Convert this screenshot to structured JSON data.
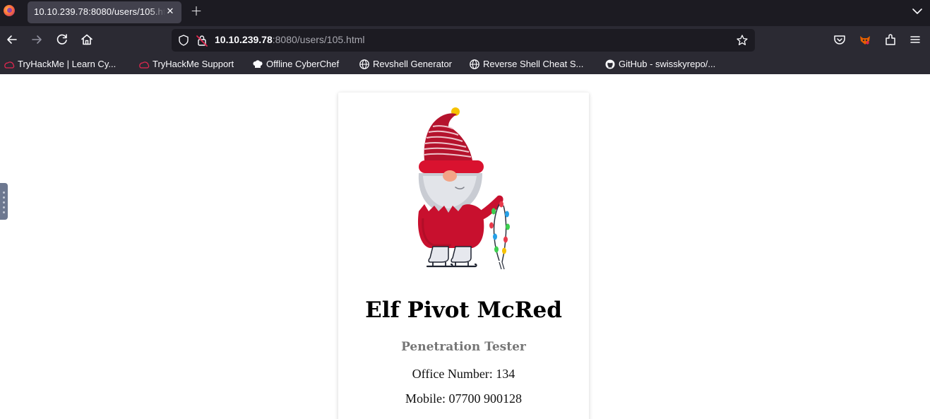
{
  "browser": {
    "tab": {
      "title": "10.10.239.78:8080/users/105.html",
      "close_icon": "close-icon"
    },
    "new_tab_icon": "plus-icon",
    "tab_list_icon": "chevron-down-icon",
    "nav": {
      "back_icon": "arrow-left-icon",
      "forward_icon": "arrow-right-icon",
      "reload_icon": "reload-icon",
      "home_icon": "home-icon"
    },
    "url": {
      "host": "10.10.239.78",
      "rest": ":8080/users/105.html"
    },
    "toolbar_icons": [
      "pocket-icon",
      "extension-fox-icon",
      "extensions-icon",
      "menu-icon"
    ],
    "bookmarks": [
      {
        "label": "TryHackMe | Learn Cy...",
        "icon": "tryhackme-icon"
      },
      {
        "label": "TryHackMe Support",
        "icon": "tryhackme-icon"
      },
      {
        "label": "Offline CyberChef",
        "icon": "chef-hat-icon"
      },
      {
        "label": "Revshell Generator",
        "icon": "globe-icon"
      },
      {
        "label": "Reverse Shell Cheat S...",
        "icon": "globe-icon"
      },
      {
        "label": "GitHub - swisskyrepo/...",
        "icon": "github-icon"
      }
    ]
  },
  "profile": {
    "name": "Elf Pivot McRed",
    "role": "Penetration Tester",
    "office": "Office Number: 134",
    "mobile": "Mobile: 07700 900128",
    "avatar_icon": "gnome-illustration"
  },
  "colors": {
    "tabbar_bg": "#1c1b22",
    "toolbar_bg": "#2b2a33",
    "role_text": "#767676",
    "gnome_red": "#c8102e"
  }
}
